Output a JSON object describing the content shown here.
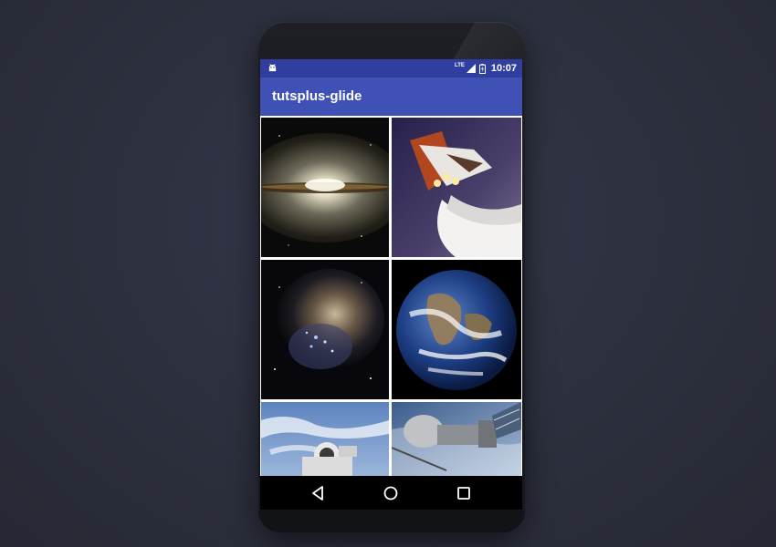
{
  "status_bar": {
    "network_label": "LTE",
    "time": "10:07",
    "icons": [
      "android-icon",
      "signal-icon",
      "battery-icon"
    ]
  },
  "app_bar": {
    "title": "tutsplus-glide"
  },
  "gallery": {
    "images": [
      {
        "subject": "sombrero-galaxy"
      },
      {
        "subject": "space-shuttle-launch"
      },
      {
        "subject": "star-cluster-nebula"
      },
      {
        "subject": "earth-from-space"
      },
      {
        "subject": "astronaut-spacewalk"
      },
      {
        "subject": "soyuz-spacecraft"
      }
    ]
  },
  "nav_bar": {
    "buttons": [
      "back-icon",
      "home-icon",
      "recents-icon"
    ]
  },
  "colors": {
    "status_bar": "#303f9f",
    "app_bar": "#3f51b5",
    "nav_bar": "#000000"
  }
}
